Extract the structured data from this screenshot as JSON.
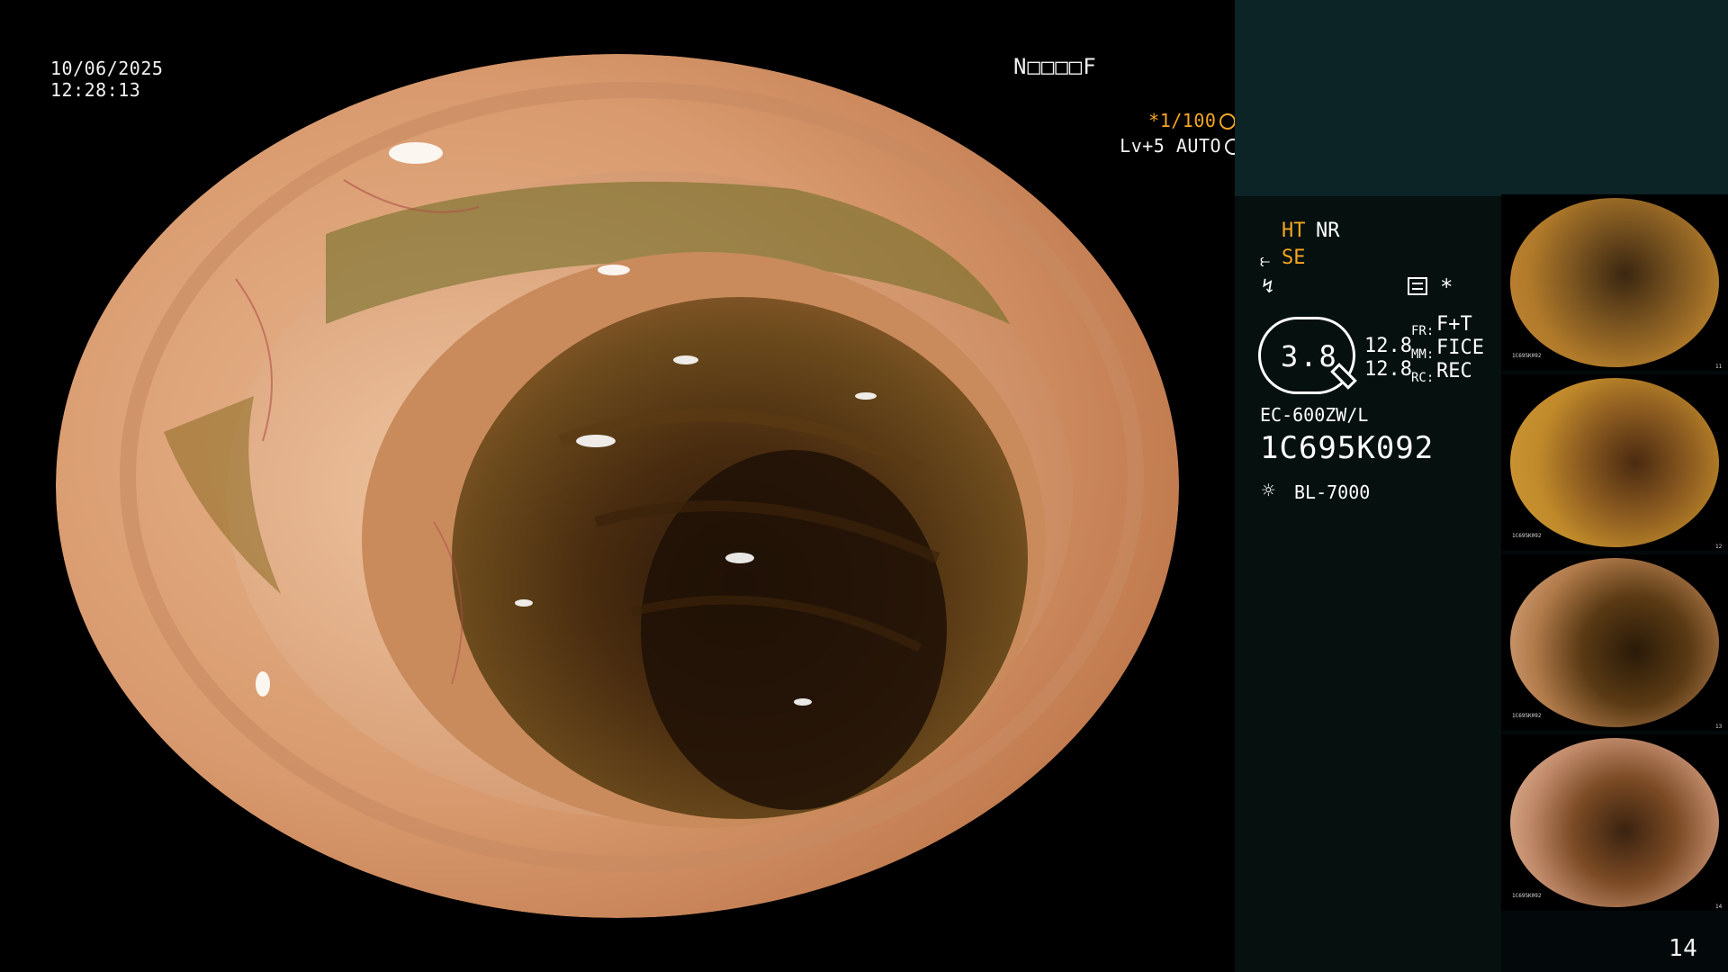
{
  "overlay": {
    "date": "10/06/2025",
    "time": "12:28:13",
    "mode_code": "N□□□□F",
    "shutter": "*1/100",
    "level": "Lv+5 AUTO"
  },
  "info": {
    "ht": "HT",
    "nr": "NR",
    "se": "SE",
    "zoom": "3.8",
    "num_a": "12.8",
    "num_b": "12.8",
    "fr_label": "FR:",
    "fr_value": "F+T",
    "mm_label": "MM:",
    "mm_value": "FICE",
    "rc_label": "RC:",
    "rc_value": "REC",
    "scope_model": "EC-600ZW/L",
    "serial": "1C695K092",
    "light_source": "BL-7000",
    "star": "*"
  },
  "thumbnails": [
    {
      "serial": "1C695K092",
      "index": "11"
    },
    {
      "serial": "1C695K092",
      "index": "12"
    },
    {
      "serial": "1C695K092",
      "index": "13"
    },
    {
      "serial": "1C695K092",
      "index": "14"
    }
  ],
  "page_number": "14",
  "colors": {
    "accent_orange": "#f5a623",
    "panel_top": "#0c2426",
    "panel_body": "#05100f"
  },
  "icons": [
    "shutter-icon",
    "auto-iris-icon",
    "structure-enhance-icon",
    "flash-icon",
    "menu-panel-icon",
    "zoom-needle-icon",
    "light-source-icon"
  ]
}
